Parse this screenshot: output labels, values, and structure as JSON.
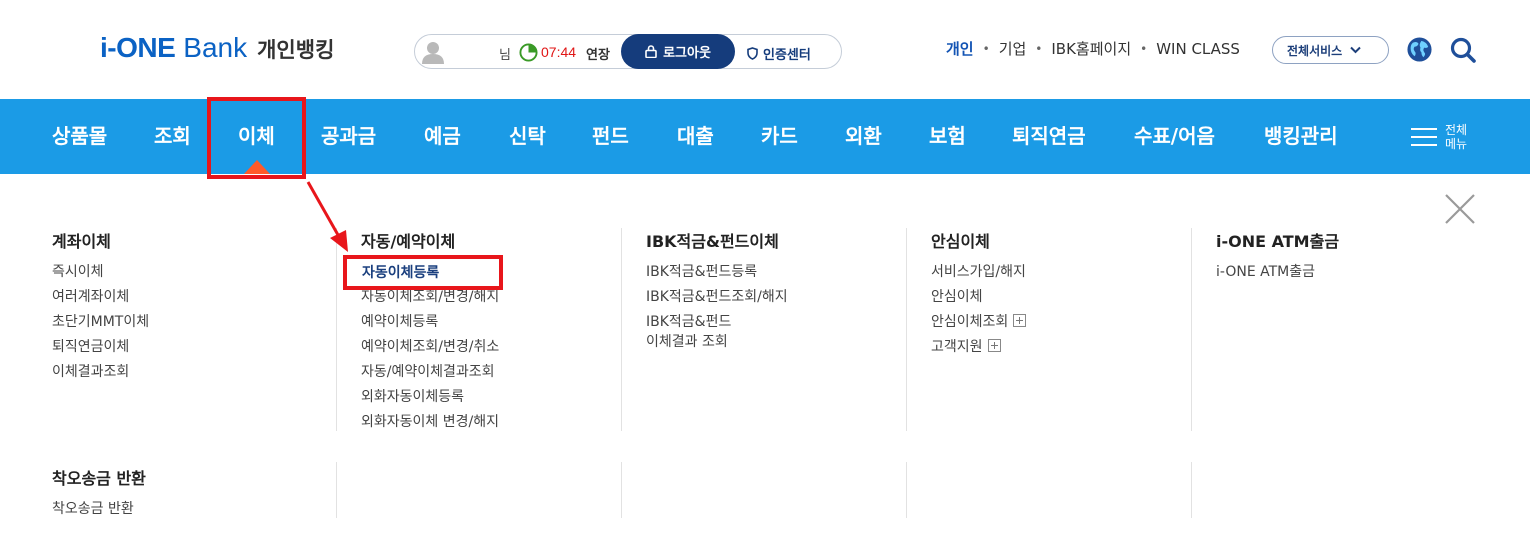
{
  "header": {
    "logo_ione": "i-ONE",
    "logo_bank": "Bank",
    "logo_sub": "개인뱅킹",
    "user_suffix": "님",
    "timer": "07:44",
    "extend_label": "연장",
    "logout_label": "로그아웃",
    "cert_label": "인증센터",
    "top_links": [
      "개인",
      "기업",
      "IBK홈페이지",
      "WIN CLASS"
    ],
    "active_link": "개인",
    "all_services": "전체서비스"
  },
  "gnb": {
    "items": [
      "상품몰",
      "조회",
      "이체",
      "공과금",
      "예금",
      "신탁",
      "펀드",
      "대출",
      "카드",
      "외환",
      "보험",
      "퇴직연금",
      "수표/어음",
      "뱅킹관리"
    ],
    "active": "이체",
    "all_menu": "전체 메뉴"
  },
  "mega_menu": {
    "columns": [
      {
        "title": "계좌이체",
        "links": [
          "즉시이체",
          "여러계좌이체",
          "초단기MMT이체",
          "퇴직연금이체",
          "이체결과조회"
        ]
      },
      {
        "title": "자동/예약이체",
        "links": [
          "자동이체등록",
          "자동이체조회/변경/해지",
          "예약이체등록",
          "예약이체조회/변경/취소",
          "자동/예약이체결과조회",
          "외화자동이체등록",
          "외화자동이체 변경/해지"
        ]
      },
      {
        "title": "IBK적금&펀드이체",
        "links": [
          "IBK적금&펀드등록",
          "IBK적금&펀드조회/해지",
          "IBK적금&펀드",
          "이체결과 조회"
        ]
      },
      {
        "title": "안심이체",
        "links": [
          "서비스가입/해지",
          "안심이체",
          "안심이체조회",
          "고객지원"
        ]
      },
      {
        "title": "i-ONE ATM출금",
        "links": [
          "i-ONE ATM출금"
        ]
      }
    ],
    "row2": {
      "title": "착오송금 반환",
      "links": [
        "착오송금 반환"
      ]
    },
    "highlighted_item": "자동이체등록"
  },
  "colors": {
    "nav_blue": "#1b9be6",
    "highlight_red": "#e8161b",
    "logo_blue": "#0b62c4",
    "logout_navy": "#153c7c"
  }
}
